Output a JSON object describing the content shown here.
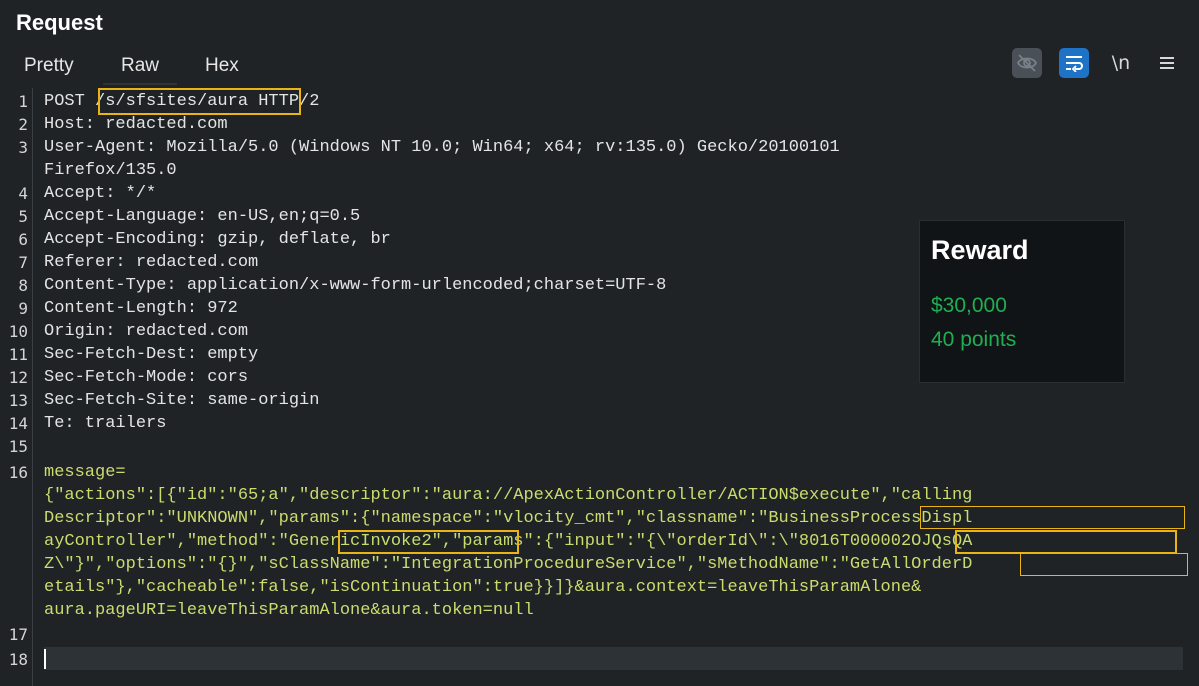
{
  "panel": {
    "title": "Request"
  },
  "tabs": [
    {
      "label": "Pretty"
    },
    {
      "label": "Raw"
    },
    {
      "label": "Hex"
    }
  ],
  "toolbar": {
    "hide_icon": "eye-slash-icon",
    "wrap_icon": "word-wrap-icon",
    "newline_label": "\\n",
    "menu_icon": "hamburger-menu-icon"
  },
  "colors": {
    "highlight": "#e8b417",
    "reward_green": "#1fae52",
    "wrap_active": "#1f73c6"
  },
  "lines": [
    {
      "n": "1",
      "text": "POST /s/sfsites/aura HTTP/2"
    },
    {
      "n": "2",
      "text": "Host: redacted.com"
    },
    {
      "n": "3",
      "text": "User-Agent: Mozilla/5.0 (Windows NT 10.0; Win64; x64; rv:135.0) Gecko/20100101"
    },
    {
      "n": "",
      "text": "Firefox/135.0"
    },
    {
      "n": "4",
      "text": "Accept: */*"
    },
    {
      "n": "5",
      "text": "Accept-Language: en-US,en;q=0.5"
    },
    {
      "n": "6",
      "text": "Accept-Encoding: gzip, deflate, br"
    },
    {
      "n": "7",
      "text": "Referer: redacted.com"
    },
    {
      "n": "8",
      "text": "Content-Type: application/x-www-form-urlencoded;charset=UTF-8"
    },
    {
      "n": "9",
      "text": "Content-Length: 972"
    },
    {
      "n": "10",
      "text": "Origin: redacted.com"
    },
    {
      "n": "11",
      "text": "Sec-Fetch-Dest: empty"
    },
    {
      "n": "12",
      "text": "Sec-Fetch-Mode: cors"
    },
    {
      "n": "13",
      "text": "Sec-Fetch-Site: same-origin"
    },
    {
      "n": "14",
      "text": "Te: trailers"
    },
    {
      "n": "15",
      "text": ""
    },
    {
      "n": "16",
      "text": "message="
    },
    {
      "n": "",
      "text": "{\"actions\":[{\"id\":\"65;a\",\"descriptor\":\"aura://ApexActionController/ACTION$execute\",\"calling"
    },
    {
      "n": "",
      "text": "Descriptor\":\"UNKNOWN\",\"params\":{\"namespace\":\"vlocity_cmt\",\"classname\":\"BusinessProcessDispl"
    },
    {
      "n": "",
      "text": "ayController\",\"method\":\"GenericInvoke2\",\"params\":{\"input\":\"{\\\"orderId\\\":\\\"8016T000002OJQsQA"
    },
    {
      "n": "",
      "text": "Z\\\"}\",\"options\":\"{}\",\"sClassName\":\"IntegrationProcedureService\",\"sMethodName\":\"GetAllOrderD"
    },
    {
      "n": "",
      "text": "etails\"},\"cacheable\":false,\"isContinuation\":true}}]}&aura.context=leaveThisParamAlone&"
    },
    {
      "n": "",
      "text": "aura.pageURI=leaveThisParamAlone&aura.token=null"
    },
    {
      "n": "17",
      "text": ""
    },
    {
      "n": "18",
      "text": ""
    }
  ],
  "reward": {
    "title": "Reward",
    "amount": "$30,000",
    "points": "40 points"
  }
}
